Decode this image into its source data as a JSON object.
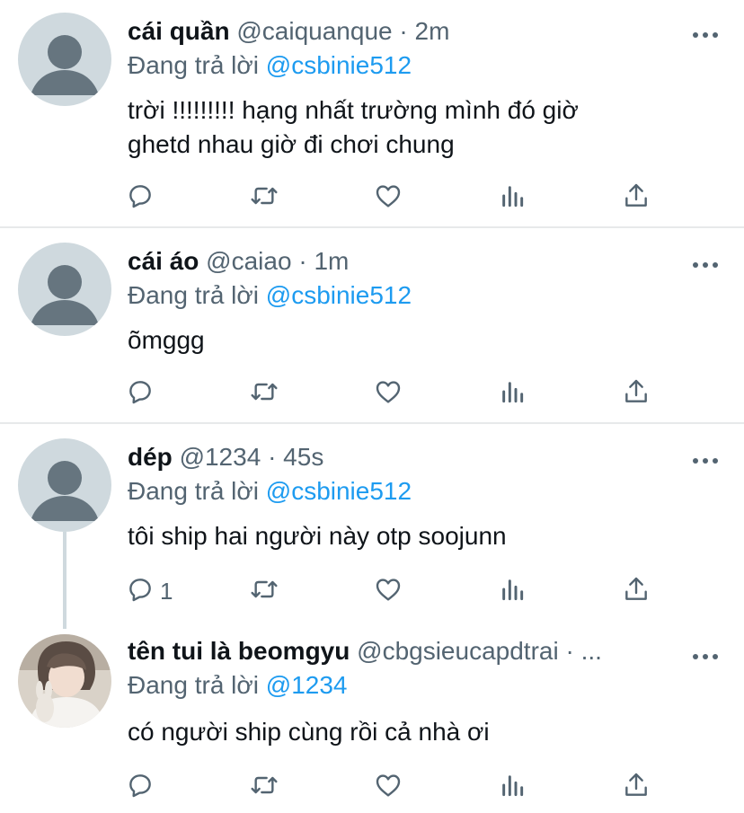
{
  "tweets": [
    {
      "name": "cái quần",
      "handle": "@caiquanque",
      "dot": "·",
      "time": "2m",
      "reply_prefix": "Đang trả lời",
      "reply_to": "@csbinie512",
      "text_lines": [
        "trời !!!!!!!!! hạng nhất trường mình đó giờ",
        "ghetd nhau giờ đi chơi chung"
      ],
      "reply_count": "",
      "avatar": "default-avatar"
    },
    {
      "name": "cái áo",
      "handle": "@caiao",
      "dot": "·",
      "time": "1m",
      "reply_prefix": "Đang trả lời",
      "reply_to": "@csbinie512",
      "text_lines": [
        "õmggg"
      ],
      "reply_count": "",
      "avatar": "default-avatar"
    },
    {
      "name": "dép",
      "handle": "@1234",
      "dot": "·",
      "time": "45s",
      "reply_prefix": "Đang trả lời",
      "reply_to": "@csbinie512",
      "text_lines": [
        "tôi ship hai người này otp soojunn"
      ],
      "reply_count": "1",
      "avatar": "default-avatar"
    },
    {
      "name": "tên tui là beomgyu",
      "handle": "@cbgsieucapdtrai",
      "dot": "·",
      "time": "...",
      "reply_prefix": "Đang trả lời",
      "reply_to": "@1234",
      "text_lines": [
        "có người ship cùng rồi cả nhà ơi"
      ],
      "reply_count": "",
      "avatar": "photo-avatar"
    }
  ],
  "icons": {
    "reply": "comment-icon",
    "retweet": "retweet-icon",
    "like": "heart-icon",
    "views": "analytics-icon",
    "share": "share-icon",
    "more": "more-icon"
  },
  "colors": {
    "mention": "#1d9bf0",
    "secondary_text": "#536471",
    "primary_text": "#0f1419",
    "divider": "#e7e9ea"
  }
}
